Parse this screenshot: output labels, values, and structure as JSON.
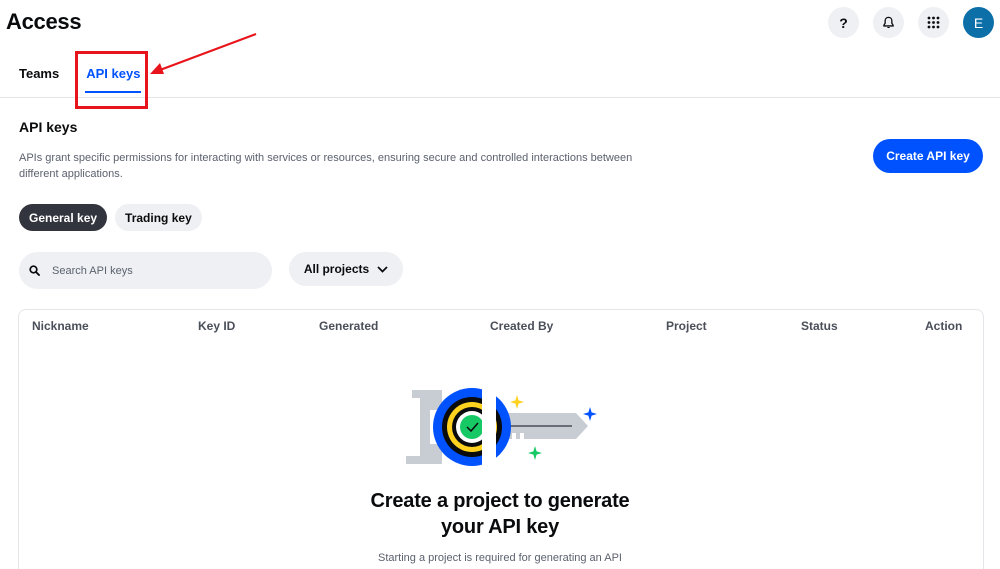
{
  "header": {
    "title": "Access",
    "actions": [
      {
        "name": "help",
        "glyph": "?"
      },
      {
        "name": "notifications"
      },
      {
        "name": "apps"
      }
    ],
    "avatar_initial": "E",
    "avatar_color": "#0d6fa8"
  },
  "tabs": [
    {
      "label": "Teams",
      "active": false
    },
    {
      "label": "API keys",
      "active": true
    }
  ],
  "annotation": {
    "color": "#e8141b",
    "target": "tab-api-keys"
  },
  "section": {
    "title": "API keys",
    "description": "APIs grant specific permissions for interacting with services or resources, ensuring secure and controlled interactions between different applications.",
    "create_button": "Create API key"
  },
  "key_types": [
    {
      "label": "General key",
      "selected": true
    },
    {
      "label": "Trading key",
      "selected": false
    }
  ],
  "search": {
    "placeholder": "Search API keys",
    "value": ""
  },
  "project_filter": {
    "label": "All projects"
  },
  "table": {
    "columns": [
      "Nickname",
      "Key ID",
      "Generated",
      "Created By",
      "Project",
      "Status",
      "Action"
    ]
  },
  "empty_state": {
    "title_line1": "Create a project to generate",
    "title_line2": "your API key",
    "description": "Starting a project is required for generating an API"
  },
  "colors": {
    "accent": "#0052ff",
    "annotation": "#e8141b"
  }
}
